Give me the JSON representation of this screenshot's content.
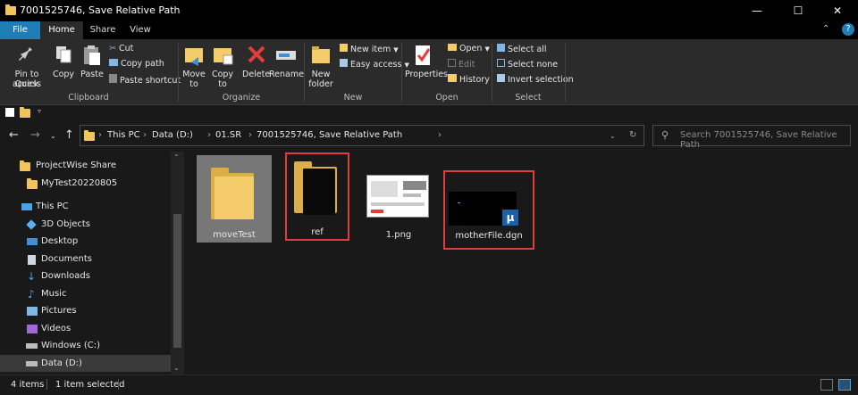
{
  "window": {
    "title": "7001525746, Save Relative Path"
  },
  "tabs": [
    "File",
    "Home",
    "Share",
    "View"
  ],
  "ribbon": {
    "clipboard": {
      "label": "Clipboard",
      "pin": "Pin to Quick",
      "pin2": "access",
      "copy": "Copy",
      "paste": "Paste",
      "cut": "Cut",
      "copy_path": "Copy path",
      "paste_shortcut": "Paste shortcut"
    },
    "organize": {
      "label": "Organize",
      "move_to": "Move",
      "move_to2": "to",
      "copy_to": "Copy",
      "copy_to2": "to",
      "delete": "Delete",
      "rename": "Rename"
    },
    "new": {
      "label": "New",
      "new_folder": "New",
      "new_folder2": "folder",
      "new_item": "New item",
      "easy_access": "Easy access"
    },
    "open": {
      "label": "Open",
      "properties": "Properties",
      "open": "Open",
      "edit": "Edit",
      "history": "History"
    },
    "select": {
      "label": "Select",
      "select_all": "Select all",
      "select_none": "Select none",
      "invert": "Invert selection"
    }
  },
  "breadcrumb": [
    "This PC",
    "Data (D:)",
    "01.SR",
    "7001525746, Save Relative Path"
  ],
  "search": {
    "placeholder": "Search 7001525746, Save Relative Path"
  },
  "nav": [
    {
      "label": "ProjectWise Share",
      "icon": "folder-icon"
    },
    {
      "label": "MyTest20220805",
      "icon": "folder-icon"
    },
    {
      "label": "This PC",
      "icon": "pc-icon"
    },
    {
      "label": "3D Objects",
      "icon": "cube-icon"
    },
    {
      "label": "Desktop",
      "icon": "desktop-icon"
    },
    {
      "label": "Documents",
      "icon": "documents-icon"
    },
    {
      "label": "Downloads",
      "icon": "download-icon"
    },
    {
      "label": "Music",
      "icon": "music-icon"
    },
    {
      "label": "Pictures",
      "icon": "pictures-icon"
    },
    {
      "label": "Videos",
      "icon": "videos-icon"
    },
    {
      "label": "Windows (C:)",
      "icon": "drive-icon"
    },
    {
      "label": "Data (D:)",
      "icon": "drive-icon"
    }
  ],
  "files": [
    {
      "name": "moveTest",
      "type": "folder"
    },
    {
      "name": "ref",
      "type": "folder-dark"
    },
    {
      "name": "1.png",
      "type": "image"
    },
    {
      "name": "motherFile.dgn",
      "type": "dgn"
    }
  ],
  "status": {
    "count": "4 items",
    "selected": "1 item selected"
  },
  "colors": {
    "accent": "#1f7db8",
    "highlight": "#e23c3c",
    "folder": "#f5cc6a"
  }
}
